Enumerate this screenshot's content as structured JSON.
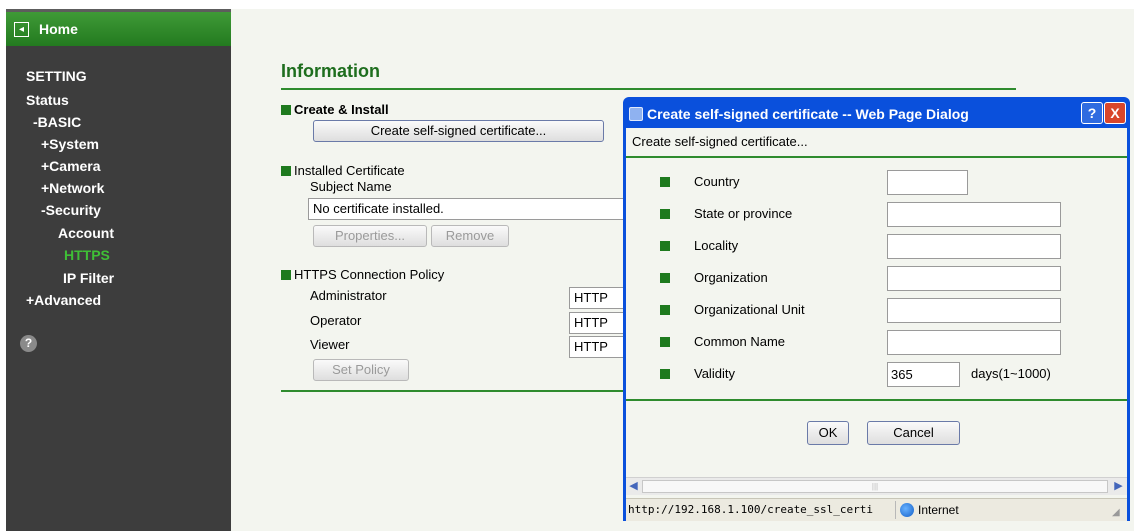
{
  "sidebar": {
    "home_label": "Home",
    "setting": "SETTING",
    "status": "Status",
    "basic": "-BASIC",
    "system": "+System",
    "camera": "+Camera",
    "network": "+Network",
    "security": "-Security",
    "account": "Account",
    "https": "HTTPS",
    "ip_filter": "IP Filter",
    "advanced": "+Advanced",
    "active_item": "HTTPS"
  },
  "main": {
    "title": "Information",
    "create_install": {
      "label": "Create & Install",
      "button": "Create self-signed certificate..."
    },
    "installed": {
      "label": "Installed Certificate",
      "subject_label": "Subject Name",
      "subject_value": "No certificate installed.",
      "properties_button": "Properties...",
      "remove_button": "Remove"
    },
    "policy": {
      "label": "HTTPS Connection Policy",
      "rows": [
        {
          "role": "Administrator",
          "value": "HTTP"
        },
        {
          "role": "Operator",
          "value": "HTTP"
        },
        {
          "role": "Viewer",
          "value": "HTTP"
        }
      ],
      "set_button": "Set Policy"
    }
  },
  "dialog": {
    "title": "Create self-signed certificate -- Web Page Dialog",
    "help_button": "?",
    "close_button": "X",
    "subtitle": "Create self-signed certificate...",
    "fields": [
      {
        "label": "Country",
        "value": ""
      },
      {
        "label": "State or province",
        "value": ""
      },
      {
        "label": "Locality",
        "value": ""
      },
      {
        "label": "Organization",
        "value": ""
      },
      {
        "label": "Organizational Unit",
        "value": ""
      },
      {
        "label": "Common Name",
        "value": ""
      },
      {
        "label": "Validity",
        "value": "365",
        "suffix": "days(1~1000)"
      }
    ],
    "ok_button": "OK",
    "cancel_button": "Cancel",
    "status_url": "http://192.168.1.100/create_ssl_certi",
    "status_zone": "Internet"
  },
  "colors": {
    "sidebar_bg": "#3d3d3d",
    "home_bar": "#2f8a28",
    "active_nav": "#3fbf36",
    "accent_green": "#1e6e1e",
    "dialog_frame": "#0a50dc",
    "page_bg": "#f3f5ef"
  },
  "icons": {
    "home": "back-arrow-icon",
    "help": "question-icon",
    "globe": "globe-icon"
  }
}
